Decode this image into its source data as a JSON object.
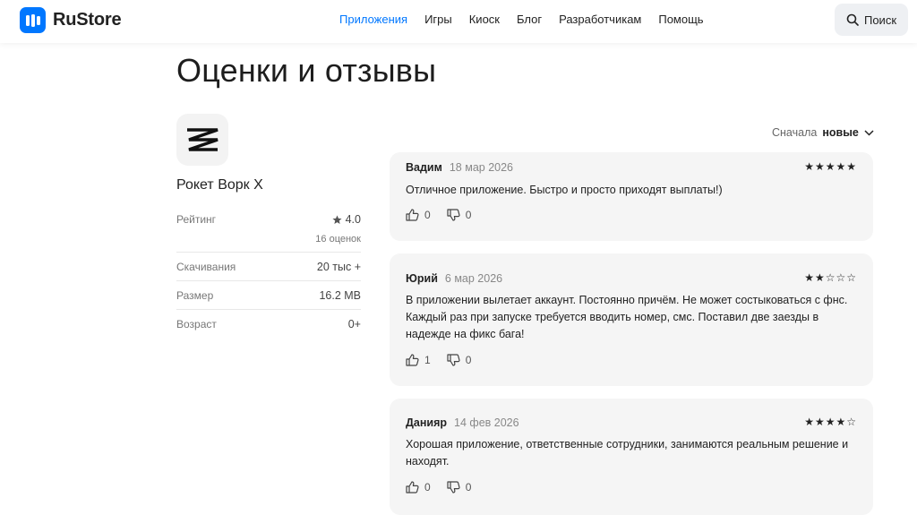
{
  "header": {
    "brand": "RuStore",
    "nav": [
      "Приложения",
      "Игры",
      "Киоск",
      "Блог",
      "Разработчикам",
      "Помощь"
    ],
    "search_label": "Поиск"
  },
  "page": {
    "title": "Оценки и отзывы"
  },
  "app": {
    "name": "Рокет Ворк X",
    "rating_label": "Рейтинг",
    "rating_value": "4.0",
    "rating_count": "16 оценок",
    "downloads_label": "Скачивания",
    "downloads_value": "20 тыс +",
    "size_label": "Размер",
    "size_value": "16.2 MB",
    "age_label": "Возраст",
    "age_value": "0+"
  },
  "sort": {
    "label": "Сначала",
    "value": "новые"
  },
  "reviews": [
    {
      "author": "Вадим",
      "date": "18 мар 2026",
      "stars": "★★★★★",
      "rating": 5,
      "text": "Отличное приложение. Быстро и просто приходят выплаты!)",
      "likes": "0",
      "dislikes": "0"
    },
    {
      "author": "Юрий",
      "date": "6 мар 2026",
      "stars": "★★☆☆☆",
      "rating": 2,
      "text": "В приложении вылетает аккаунт. Постоянно причём. Не может состыковаться с фнс. Каждый раз при запуске требуется вводить номер, смс. Поставил две заезды в надежде на фикс бага!",
      "likes": "1",
      "dislikes": "0"
    },
    {
      "author": "Данияр",
      "date": "14 фев 2026",
      "stars": "★★★★☆",
      "rating": 4,
      "text": "Хорошая приложение, ответственные сотрудники, занимаются реальным решение и находят.",
      "likes": "0",
      "dislikes": "0"
    }
  ],
  "colors": {
    "accent": "#0077ff",
    "card_bg": "#f5f5f5",
    "muted_text": "#777777"
  }
}
